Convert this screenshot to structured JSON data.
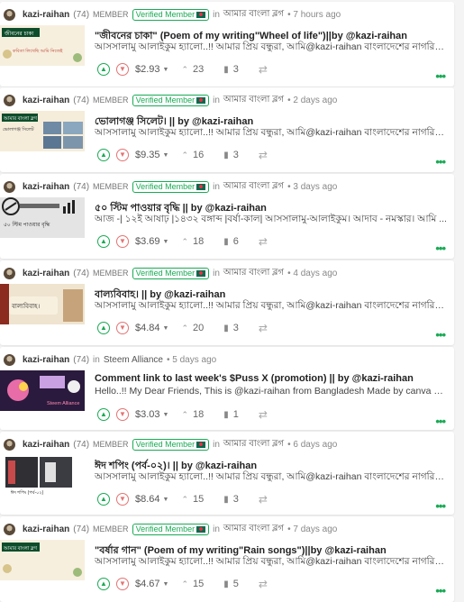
{
  "feed": {
    "posts": [
      {
        "author": "kazi-raihan",
        "reputation": "(74)",
        "role": "MEMBER",
        "badge": "Verified Member",
        "in_label": "in",
        "community": "আমার বাংলা ব্লগ",
        "time": "• 7 hours ago",
        "title": "\"জীবনের চাকা\" (Poem of my writing\"Wheel of life\")||by @kazi-raihan",
        "summary": "আসসালামু আলাইকুম হ্যালো..!! আমার প্রিয় বন্ধুরা, আমি@kazi-raihan বাংলাদেশের নাগরিক...",
        "payout": "$2.93",
        "votes": "23",
        "comments": "3"
      },
      {
        "author": "kazi-raihan",
        "reputation": "(74)",
        "role": "MEMBER",
        "badge": "Verified Member",
        "in_label": "in",
        "community": "আমার বাংলা ব্লগ",
        "time": "• 2 days ago",
        "title": "ভোলাগঞ্জ সিলেট। || by @kazi-raihan",
        "summary": "আসসালামু আলাইকুম হ্যালো..!! আমার প্রিয় বন্ধুরা, আমি@kazi-raihan বাংলাদেশের নাগরিক...",
        "payout": "$9.35",
        "votes": "16",
        "comments": "3"
      },
      {
        "author": "kazi-raihan",
        "reputation": "(74)",
        "role": "MEMBER",
        "badge": "Verified Member",
        "in_label": "in",
        "community": "আমার বাংলা ব্লগ",
        "time": "• 3 days ago",
        "title": "৫০ স্টিম পাওয়ার বৃদ্ধি || by @kazi-raihan",
        "summary": "আজ -| ১২ই আষাঢ় |১৪৩২ বঙ্গাব্দ |বর্ষা-কাল| আসসালামু-আলাইকুম। আদাব - নমস্কার। আমি ...",
        "payout": "$3.69",
        "votes": "18",
        "comments": "6"
      },
      {
        "author": "kazi-raihan",
        "reputation": "(74)",
        "role": "MEMBER",
        "badge": "Verified Member",
        "in_label": "in",
        "community": "আমার বাংলা ব্লগ",
        "time": "• 4 days ago",
        "title": "বাল্যবিবাহ। || by @kazi-raihan",
        "summary": "আসসালামু আলাইকুম হ্যালো..!! আমার প্রিয় বন্ধুরা, আমি@kazi-raihan বাংলাদেশের নাগরিক...",
        "payout": "$4.84",
        "votes": "20",
        "comments": "3"
      },
      {
        "author": "kazi-raihan",
        "reputation": "(74)",
        "role": "",
        "badge": "",
        "in_label": "in",
        "community": "Steem Alliance",
        "time": "• 5 days ago",
        "title": "Comment link to last week's $Puss X (promotion) || by @kazi-raihan",
        "summary": "Hello..!! My Dear Friends, This is @kazi-raihan from Bangladesh Made by canva $PUS...",
        "payout": "$3.03",
        "votes": "18",
        "comments": "1"
      },
      {
        "author": "kazi-raihan",
        "reputation": "(74)",
        "role": "MEMBER",
        "badge": "Verified Member",
        "in_label": "in",
        "community": "আমার বাংলা ব্লগ",
        "time": "• 6 days ago",
        "title": "ঈদ শপিং (পর্ব-০২)। || by @kazi-raihan",
        "summary": "আসসালামু আলাইকুম হ্যালো..!! আমার প্রিয় বন্ধুরা, আমি@kazi-raihan বাংলাদেশের নাগরিক...",
        "payout": "$8.64",
        "votes": "15",
        "comments": "3"
      },
      {
        "author": "kazi-raihan",
        "reputation": "(74)",
        "role": "MEMBER",
        "badge": "Verified Member",
        "in_label": "in",
        "community": "আমার বাংলা ব্লগ",
        "time": "• 7 days ago",
        "title": "\"বর্ষার গান\" (Poem of my writing\"Rain songs\")||by @kazi-raihan",
        "summary": "আসসালামু আলাইকুম হ্যালো..!! আমার প্রিয় বন্ধুরা, আমি@kazi-raihan বাংলাদেশের নাগরিক...",
        "payout": "$4.67",
        "votes": "15",
        "comments": "5"
      }
    ],
    "thumb_texts": {
      "t1_top": "জীবনের চাকা",
      "t1_bottom": "কবিতা লিখেছি আমি নিজেই",
      "t2_top": "আমার বাংলা ব্লগ",
      "t2_mid": "ভোলাগঞ্জ সিলেট",
      "t3_caption": "৫০ স্টিম পাওয়ার বৃদ্ধি",
      "t4_caption": "বাল্যবিবাহ।",
      "t5_caption": "Steem Alliance",
      "t6_caption": "ঈদ শপিং (পর্ব-০২)",
      "t7_top": "আমার বাংলা ব্লগ"
    },
    "icons": {
      "upvote": "chevron-up-icon",
      "downvote": "chevron-down-icon",
      "votes": "caret-up-icon",
      "comments": "comment-icon",
      "resteem": "repeat-icon",
      "more": "dots-icon",
      "badge_flag": "bangladesh-flag-icon"
    },
    "colors": {
      "accent": "#1aaa55",
      "downvote": "#e57373",
      "background": "#f4f4f4"
    }
  }
}
